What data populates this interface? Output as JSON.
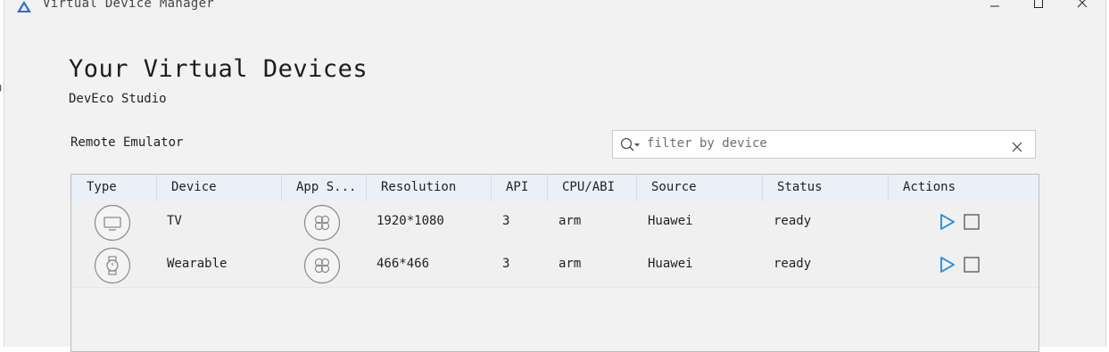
{
  "window": {
    "title": "Virtual Device Manager",
    "icon": "deveco-logo-icon",
    "controls": [
      "minimize-icon",
      "maximize-icon",
      "close-icon"
    ]
  },
  "page": {
    "heading": "Your Virtual Devices",
    "subheading": "DevEco Studio",
    "section_label": "Remote Emulator"
  },
  "filter": {
    "value": "",
    "placeholder": "filter by device",
    "icon": "search-icon",
    "clear_icon": "clear-icon"
  },
  "table": {
    "columns": [
      "Type",
      "Device",
      "App S...",
      "Resolution",
      "API",
      "CPU/ABI",
      "Source",
      "Status",
      "Actions"
    ],
    "rows": [
      {
        "type_icon": "tv-icon",
        "device": "TV",
        "app_icon": "app-service-icon",
        "resolution": "1920*1080",
        "api": "3",
        "cpu": "arm",
        "source": "Huawei",
        "status": "ready",
        "actions": [
          "play-icon",
          "stop-icon"
        ]
      },
      {
        "type_icon": "watch-icon",
        "device": "Wearable",
        "app_icon": "app-service-icon",
        "resolution": "466*466",
        "api": "3",
        "cpu": "arm",
        "source": "Huawei",
        "status": "ready",
        "actions": [
          "play-icon",
          "stop-icon"
        ]
      }
    ]
  },
  "colors": {
    "accent": "#1e88e5",
    "header_bg": "#eaf0f8",
    "window_bg": "#f2f2f2"
  }
}
